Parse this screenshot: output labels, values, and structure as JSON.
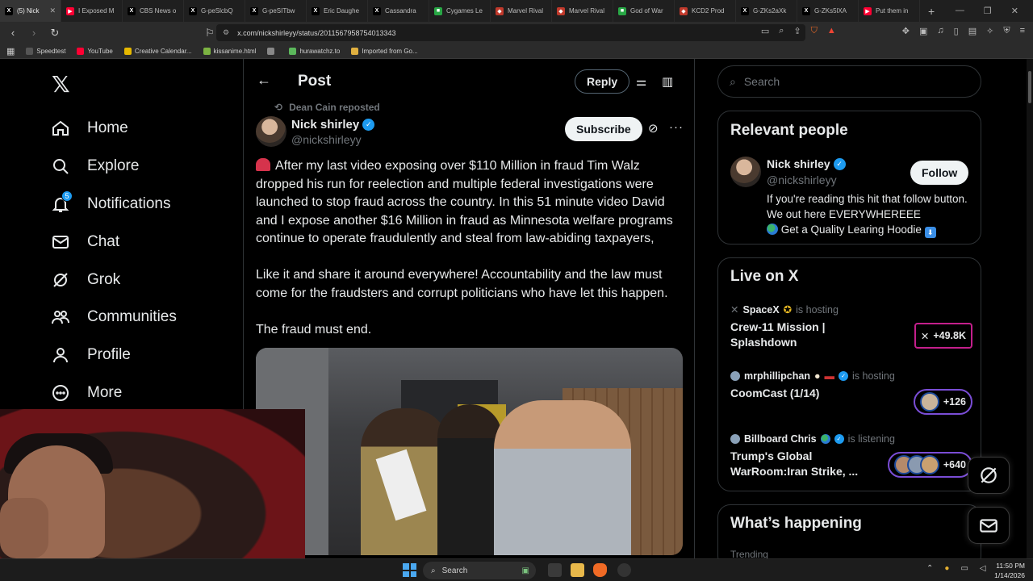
{
  "browser": {
    "tabs": [
      {
        "title": "(5) Nick",
        "color": "#000000",
        "glyph": "X",
        "active": true
      },
      {
        "title": "I Exposed M",
        "color": "#ff0033",
        "glyph": "▶"
      },
      {
        "title": "CBS News o",
        "color": "#000000",
        "glyph": "X"
      },
      {
        "title": "G-peSlcbQ",
        "color": "#000000",
        "glyph": "X"
      },
      {
        "title": "G-peSITbw",
        "color": "#000000",
        "glyph": "X"
      },
      {
        "title": "Eric Daughe",
        "color": "#000000",
        "glyph": "X"
      },
      {
        "title": "Cassandra",
        "color": "#000000",
        "glyph": "X"
      },
      {
        "title": "Cygames Le",
        "color": "#28a745",
        "glyph": "■"
      },
      {
        "title": "Marvel Rival",
        "color": "#c0392b",
        "glyph": "◆"
      },
      {
        "title": "Marvel Rival",
        "color": "#c0392b",
        "glyph": "◆"
      },
      {
        "title": "God of War",
        "color": "#28a745",
        "glyph": "■"
      },
      {
        "title": "KCD2 Prod",
        "color": "#c0392b",
        "glyph": "◆"
      },
      {
        "title": "G-ZKs2aXk",
        "color": "#000000",
        "glyph": "X"
      },
      {
        "title": "G-ZKs5lXA",
        "color": "#000000",
        "glyph": "X"
      },
      {
        "title": "Put them in",
        "color": "#ff0033",
        "glyph": "▶"
      }
    ],
    "url": "x.com/nickshirleyy/status/2011567958754013343",
    "bookmarks": [
      {
        "label": "Speedtest",
        "color": "#555555"
      },
      {
        "label": "YouTube",
        "color": "#ff0033"
      },
      {
        "label": "Creative Calendar...",
        "color": "#e6b800"
      },
      {
        "label": "kissanime.html",
        "color": "#7cb342"
      },
      {
        "label": "",
        "color": "#888888"
      },
      {
        "label": "hurawatchz.to",
        "color": "#5cb85c"
      },
      {
        "label": "Imported from Go...",
        "color": "#e0b040"
      }
    ]
  },
  "sidebar": {
    "items": [
      {
        "label": "Home",
        "icon": "home-icon"
      },
      {
        "label": "Explore",
        "icon": "search-icon"
      },
      {
        "label": "Notifications",
        "icon": "bell-icon",
        "badge": "5"
      },
      {
        "label": "Chat",
        "icon": "mail-icon"
      },
      {
        "label": "Grok",
        "icon": "grok-icon"
      },
      {
        "label": "Communities",
        "icon": "people-icon"
      },
      {
        "label": "Profile",
        "icon": "person-icon"
      },
      {
        "label": "More",
        "icon": "more-circle-icon"
      }
    ]
  },
  "post_header": {
    "title": "Post",
    "reply_label": "Reply"
  },
  "post": {
    "reposted_by": "Dean Cain reposted",
    "author_name": "Nick shirley",
    "author_handle": "@nickshirleyy",
    "subscribe_label": "Subscribe",
    "paragraphs": [
      "After my last video exposing over $110 Million in fraud Tim Walz dropped his run for reelection and multiple federal investigations were launched to stop  fraud across the country. In this 51 minute video David and I expose another $16 Million in fraud as Minnesota welfare programs continue to operate fraudulently and steal from law-abiding taxpayers,",
      "Like it and share it around everywhere! Accountability and the law must come for the fraudsters and corrupt politicians who have let this happen.",
      "The fraud must end."
    ]
  },
  "right": {
    "search_placeholder": "Search",
    "relevant_title": "Relevant people",
    "relevant_person": {
      "name": "Nick shirley",
      "handle": "@nickshirleyy",
      "follow_label": "Follow",
      "bio_line1": "If you're reading this hit that follow button. We out here EVERYWHEREEE",
      "bio_line2": "Get a Quality Learing Hoodie"
    },
    "live_title": "Live on X",
    "live": [
      {
        "host": "SpaceX",
        "verb": "is hosting",
        "title": "Crew-11 Mission | Splashdown",
        "count": "+49.8K"
      },
      {
        "host": "mrphillipchan",
        "verb": "is hosting",
        "title": "CoomCast (1/14)",
        "count": "+126"
      },
      {
        "host": "Billboard Chris",
        "verb": "is listening",
        "title": "Trump's Global WarRoom:Iran Strike, ...",
        "count": "+640"
      }
    ],
    "happening_title": "What’s happening",
    "trending_label": "Trending"
  },
  "taskbar": {
    "search_label": "Search",
    "time": "11:50 PM",
    "date": "1/14/2026"
  }
}
